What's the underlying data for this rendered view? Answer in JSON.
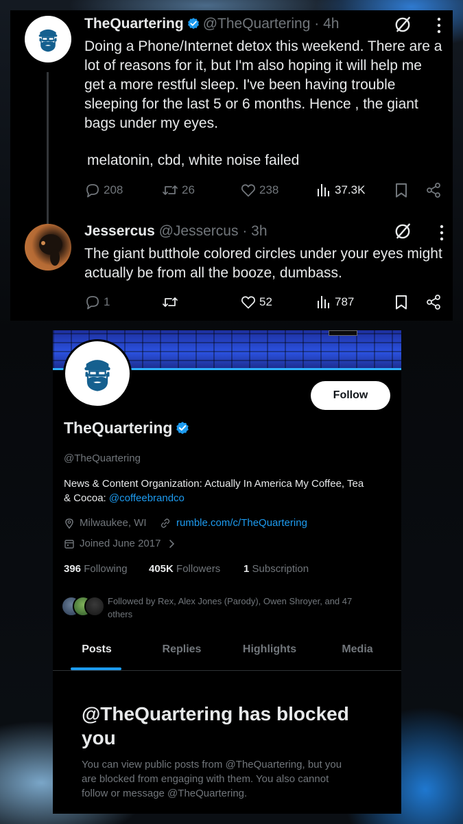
{
  "tweet1": {
    "name": "TheQuartering",
    "handle": "@TheQuartering",
    "time": "· 4h",
    "text_lines": [
      "Doing a Phone/Internet detox this weekend.  There are a",
      "lot of reasons for it, but I'm also hoping it will help me",
      "get a more restful sleep. I've been having trouble",
      "sleeping for the last 5 or 6 months. Hence , the giant",
      "bags under my eyes."
    ],
    "text_extra": "melatonin, cbd, white noise failed",
    "replies": "208",
    "reposts": "26",
    "likes": "238",
    "views": "37.3K"
  },
  "tweet2": {
    "name": "Jessercus",
    "handle": "@Jessercus",
    "time": "· 3h",
    "text_lines": [
      "The giant butthole colored circles under your eyes might",
      "actually be from all the booze, dumbass."
    ],
    "replies": "1",
    "reposts": "",
    "likes": "52",
    "views": "787"
  },
  "profile": {
    "follow_label": "Follow",
    "name": "TheQuartering",
    "handle": "@TheQuartering",
    "bio_line1": "News & Content Organization: Actually In America My Coffee, Tea",
    "bio_line2_prefix": "& Cocoa: ",
    "bio_link": "@coffeebrandco",
    "location": "Milwaukee, WI",
    "website": "rumble.com/c/TheQuartering",
    "joined": "Joined June 2017",
    "following_count": "396",
    "following_label": "Following",
    "followers_count": "405K",
    "followers_label": "Followers",
    "subscription_count": "1",
    "subscription_label": "Subscription",
    "followed_by_line1": "Followed by Rex, Alex Jones (Parody), Owen Shroyer, and 47",
    "followed_by_line2": "others",
    "tabs": [
      "Posts",
      "Replies",
      "Highlights",
      "Media"
    ],
    "active_tab": "Posts",
    "blocked_title_line1": "@TheQuartering has blocked",
    "blocked_title_line2": "you",
    "blocked_text_lines": [
      "You can view public posts from @TheQuartering, but you",
      "are blocked from engaging with them. You also cannot",
      "follow or message @TheQuartering."
    ]
  },
  "colors": {
    "accent": "#1d9bf0",
    "logo": "#15608f",
    "background": "#000000",
    "text": "#e7e9ea",
    "muted": "#71767b"
  },
  "icons": [
    "verified-badge-icon",
    "grok-icon",
    "more-icon",
    "reply-icon",
    "repost-icon",
    "like-icon",
    "views-icon",
    "bookmark-icon",
    "share-icon",
    "location-icon",
    "link-icon",
    "calendar-icon",
    "chevron-right-icon"
  ]
}
